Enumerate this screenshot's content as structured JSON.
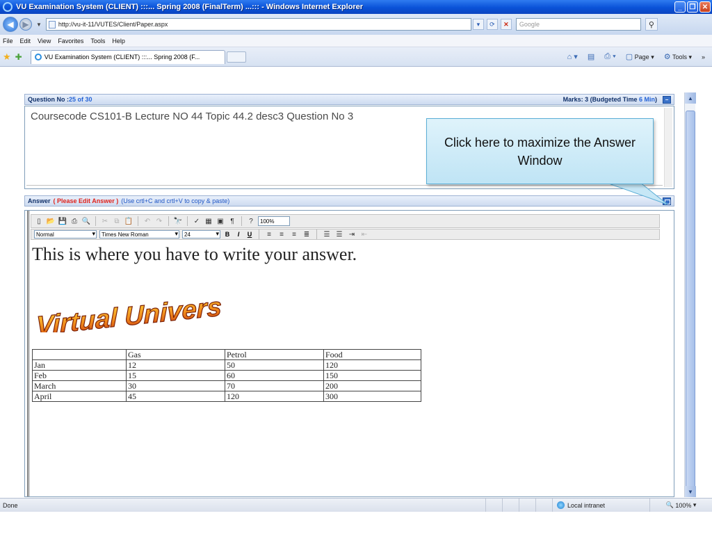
{
  "window": {
    "title": "VU Examination System (CLIENT) :::... Spring 2008 (FinalTerm) ...::: - Windows Internet Explorer"
  },
  "browser": {
    "url": "http://vu-it-11/VUTES/Client/Paper.aspx",
    "search_placeholder": "Google",
    "menu": [
      "File",
      "Edit",
      "View",
      "Favorites",
      "Tools",
      "Help"
    ],
    "tab_title": "VU Examination System (CLIENT) :::... Spring 2008 (F...",
    "page_label": "Page",
    "tools_label": "Tools"
  },
  "question": {
    "number_label": "Question No : ",
    "number_value": "25 of 30",
    "marks_label": "Marks: 3 (Budgeted Time ",
    "time_value": "6 Min",
    "marks_close": ")",
    "text": "Coursecode CS101-B Lecture NO 44  Topic 44.2 desc3  Question No  3"
  },
  "answer": {
    "header_label": "Answer",
    "edit_hint": "( Please Edit Answer )",
    "copy_hint": "(Use crtl+C and crtl+V to copy & paste)",
    "style_select": "Normal",
    "font_select": "Times New Roman",
    "size_select": "24",
    "zoom_select": "100%",
    "body_text": "This is where you have to write your answer.",
    "logo_text": "Virtual University"
  },
  "table": {
    "headers": [
      "",
      "Gas",
      "Petrol",
      "Food"
    ],
    "rows": [
      [
        "Jan",
        "12",
        "50",
        "120"
      ],
      [
        "Feb",
        "15",
        "60",
        "150"
      ],
      [
        "March",
        "30",
        "70",
        "200"
      ],
      [
        "April",
        "45",
        "120",
        "300"
      ]
    ]
  },
  "callout": {
    "text": "Click here to maximize the Answer Window"
  },
  "status": {
    "left": "Done",
    "zone": "Local intranet",
    "zoom": "100%"
  },
  "colors": {
    "accent_blue": "#2463d6",
    "hint_red": "#e0231c",
    "callout_fill": "#bfe4f5"
  }
}
